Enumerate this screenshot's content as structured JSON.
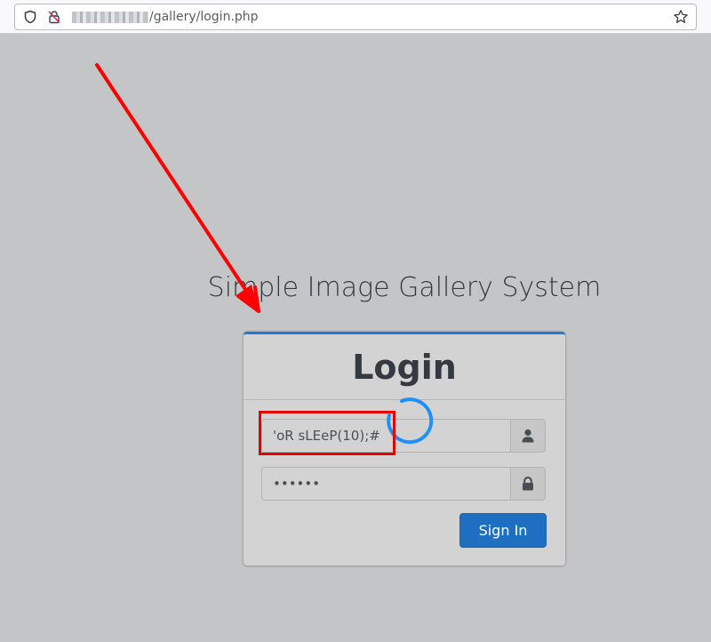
{
  "browser": {
    "url_path": "/gallery/login.php",
    "icons": [
      "shield-icon",
      "insecure-lock-icon",
      "bookmark-star-icon"
    ]
  },
  "page": {
    "title": "Simple Image Gallery System"
  },
  "login_card": {
    "heading": "Login",
    "username_value": "'oR sLEeP(10);#",
    "password_value": "••••••",
    "sign_in_label": "Sign In",
    "username_addon_icon": "user-icon",
    "password_addon_icon": "lock-icon"
  },
  "colors": {
    "page_background": "#c4c5c7",
    "card_accent": "#1e7bd6",
    "button": "#1e6fc2",
    "spinner": "#1e8fff",
    "annotation": "#e60000"
  }
}
